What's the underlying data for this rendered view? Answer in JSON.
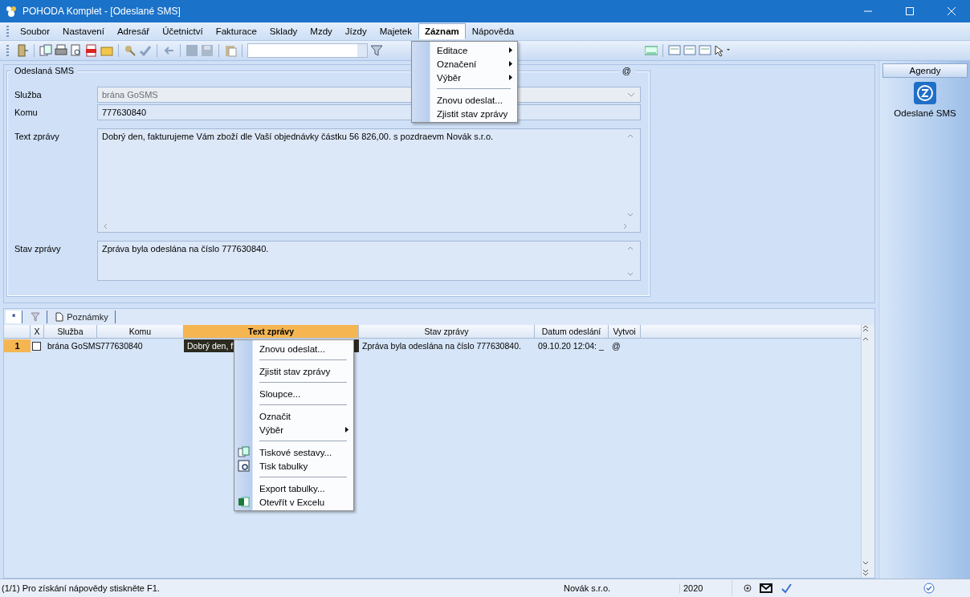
{
  "window": {
    "title": "POHODA Komplet - [Odeslané SMS]"
  },
  "menu_bar": [
    {
      "label": "Soubor",
      "selected": false
    },
    {
      "label": "Nastavení",
      "selected": false
    },
    {
      "label": "Adresář",
      "selected": false
    },
    {
      "label": "Účetnictví",
      "selected": false
    },
    {
      "label": "Fakturace",
      "selected": false
    },
    {
      "label": "Sklady",
      "selected": false
    },
    {
      "label": "Mzdy",
      "selected": false
    },
    {
      "label": "Jízdy",
      "selected": false
    },
    {
      "label": "Majetek",
      "selected": false
    },
    {
      "label": "Záznam",
      "selected": true
    },
    {
      "label": "Nápověda",
      "selected": false
    }
  ],
  "form": {
    "title": "Odeslaná SMS",
    "marker": "@",
    "fields": [
      {
        "label": "Služba",
        "value": "brána GoSMS",
        "kind": "combo",
        "disabled": true
      },
      {
        "label": "Komu",
        "value": "777630840",
        "kind": "text",
        "disabled": false
      },
      {
        "label": "Text zprávy",
        "value": "Dobrý den, fakturujeme Vám zboží dle Vaší objednávky částku 56 826,00. s pozdraevm Novák s.r.o.",
        "kind": "memo",
        "disabled": false
      },
      {
        "label": "Stav zprávy",
        "value": "Zpráva byla odeslána na číslo 777630840.",
        "kind": "note",
        "disabled": false
      }
    ]
  },
  "grid": {
    "tabs": [
      {
        "label": "*",
        "kind": "text"
      },
      {
        "kind": "filter"
      },
      {
        "label": "Poznámky",
        "kind": "note"
      }
    ],
    "checkbox_column": {
      "label": "X"
    },
    "columns": [
      {
        "label": "Služba",
        "selected": false
      },
      {
        "label": "Komu",
        "selected": false
      },
      {
        "label": "Text zprávy",
        "selected": true
      },
      {
        "label": "Stav zprávy",
        "selected": false
      },
      {
        "label": "Datum odeslání",
        "selected": false
      },
      {
        "label": "Vytvoi",
        "selected": false
      }
    ],
    "rows": [
      {
        "number": "1",
        "checked": false,
        "cells": [
          "brána GoSMS",
          "777630840",
          "Dobrý den, f",
          "Zpráva byla odeslána na číslo 777630840.",
          "09.10.20 12:04: _",
          "@"
        ]
      }
    ]
  },
  "dropdown_menu": {
    "items": [
      {
        "label": "Editace",
        "kind": "submenu"
      },
      {
        "label": "Označení",
        "kind": "submenu"
      },
      {
        "label": "Výběr",
        "kind": "submenu"
      },
      {
        "kind": "separator"
      },
      {
        "label": "Znovu odeslat...",
        "kind": "item"
      },
      {
        "label": "Zjistit stav zprávy",
        "kind": "item"
      }
    ]
  },
  "context_menu": {
    "items": [
      {
        "label": "Znovu odeslat...",
        "kind": "item"
      },
      {
        "kind": "separator"
      },
      {
        "label": "Zjistit stav zprávy",
        "kind": "item"
      },
      {
        "kind": "separator"
      },
      {
        "label": "Sloupce...",
        "kind": "item"
      },
      {
        "kind": "separator"
      },
      {
        "label": "Označit",
        "kind": "item"
      },
      {
        "label": "Výběr",
        "kind": "submenu"
      },
      {
        "kind": "separator"
      },
      {
        "label": "Tiskové sestavy...",
        "kind": "icon"
      },
      {
        "label": "Tisk tabulky",
        "kind": "icon"
      },
      {
        "kind": "separator"
      },
      {
        "label": "Export tabulky...",
        "kind": "item"
      },
      {
        "label": "Otevřít v Excelu",
        "kind": "icon"
      }
    ]
  },
  "agendas": {
    "title": "Agendy",
    "items": [
      {
        "label": "Odeslané SMS"
      }
    ]
  },
  "status_bar": {
    "message": "(1/1) Pro získání nápovědy stiskněte F1.",
    "company": "Novák s.r.o.",
    "year": "2020"
  }
}
